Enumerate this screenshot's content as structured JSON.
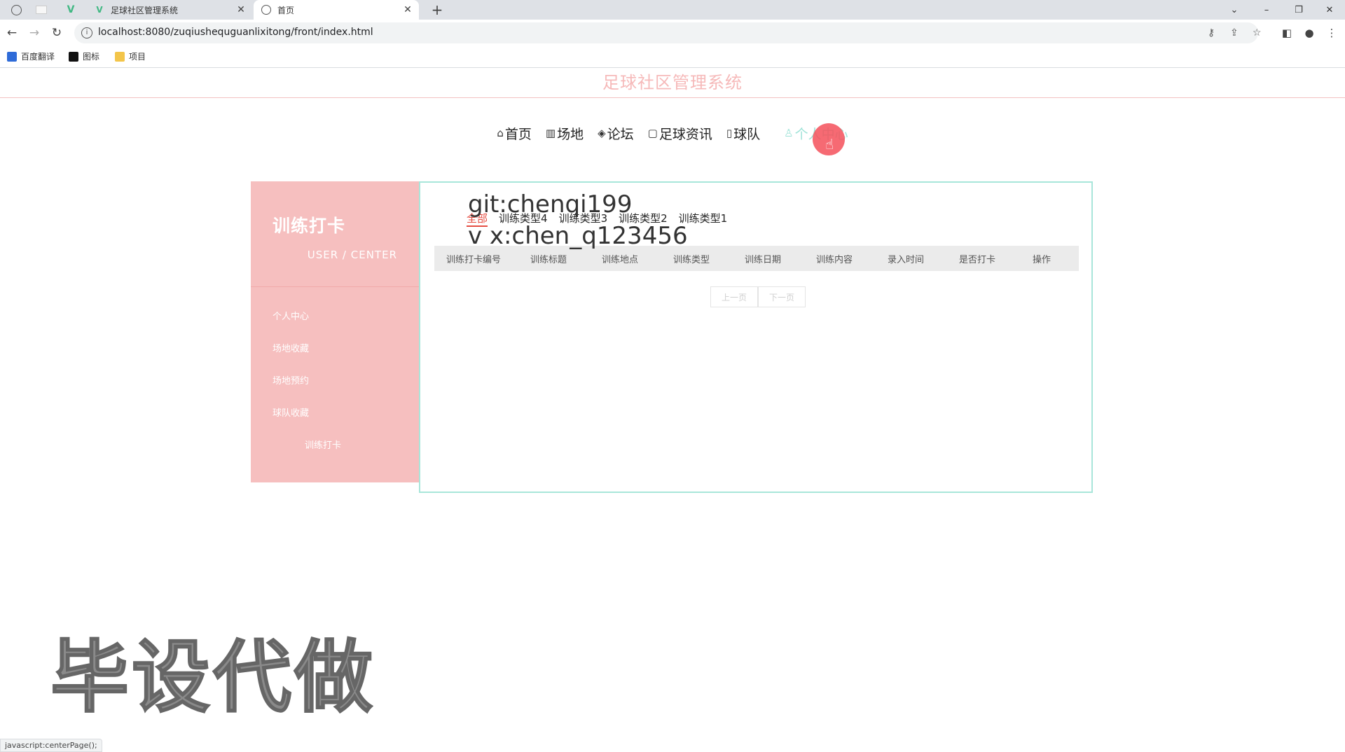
{
  "browser": {
    "tabs": [
      {
        "title": "足球社区管理系统",
        "active": false
      },
      {
        "title": "首页",
        "active": true
      }
    ],
    "new_tab_label": "+",
    "url": "localhost:8080/zuqiushequguanlixitong/front/index.html",
    "bookmarks": [
      {
        "label": "百度翻译",
        "color": "#2f6bd8"
      },
      {
        "label": "图标",
        "color": "#111111"
      },
      {
        "label": "项目",
        "color": "#f3c54a"
      }
    ]
  },
  "site": {
    "title": "足球社区管理系统",
    "nav": [
      {
        "icon": "⌂",
        "label": "首页",
        "active": false
      },
      {
        "icon": "▥",
        "label": "场地",
        "active": false
      },
      {
        "icon": "◈",
        "label": "论坛",
        "active": false
      },
      {
        "icon": "▢",
        "label": "足球资讯",
        "active": false
      },
      {
        "icon": "▯",
        "label": "球队",
        "active": false
      },
      {
        "icon": "♙",
        "label": "个人中心",
        "active": true
      }
    ]
  },
  "sidebar": {
    "title": "训练打卡",
    "subtitle": "USER / CENTER",
    "items": [
      {
        "label": "个人中心"
      },
      {
        "label": "场地收藏"
      },
      {
        "label": "场地预约"
      },
      {
        "label": "球队收藏"
      },
      {
        "label": "训练打卡",
        "active": true
      }
    ]
  },
  "content": {
    "filters": [
      "全部",
      "训练类型4",
      "训练类型3",
      "训练类型2",
      "训练类型1"
    ],
    "active_filter": "全部",
    "columns": [
      "训练打卡编号",
      "训练标题",
      "训练地点",
      "训练类型",
      "训练日期",
      "训练内容",
      "录入时间",
      "是否打卡",
      "操作"
    ],
    "pager": {
      "prev": "上一页",
      "next": "下一页"
    }
  },
  "overlay": {
    "git": "git:chenqi199",
    "vx": "v x:chen_q123456",
    "big": "毕设代做"
  },
  "statusbar": "javascript:centerPage();",
  "colors": {
    "accent_pink": "#f6bfbf",
    "accent_teal": "#a8e6da",
    "active_filter": "#e54d42"
  }
}
